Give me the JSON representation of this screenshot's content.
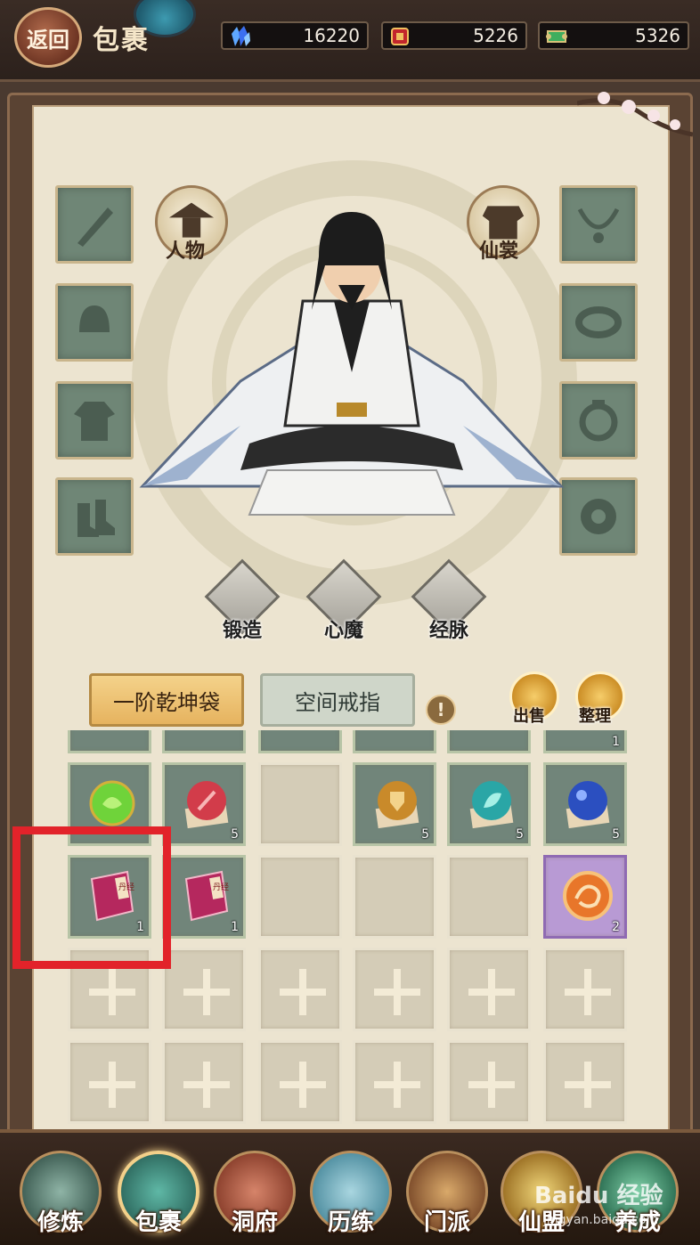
{
  "header": {
    "back_label": "返回",
    "title": "包裹"
  },
  "currencies": [
    {
      "icon": "crystal-icon",
      "value": "16220"
    },
    {
      "icon": "red-seal-icon",
      "value": "5226"
    },
    {
      "icon": "green-scroll-icon",
      "value": "5326"
    }
  ],
  "character_tabs": {
    "character_label": "人物",
    "outfit_label": "仙裳"
  },
  "equipment_slots_left": [
    "sword-icon",
    "helmet-icon",
    "robe-icon",
    "boots-icon"
  ],
  "equipment_slots_right": [
    "necklace-icon",
    "bracelet-icon",
    "ring-icon",
    "jade-icon"
  ],
  "actions": {
    "forge_label": "锻造",
    "heart_demon_label": "心魔",
    "meridian_label": "经脉"
  },
  "bag_tabs": {
    "bag_label": "一阶乾坤袋",
    "ring_label": "空间戒指"
  },
  "info_symbol": "!",
  "bag_actions": {
    "sell_label": "出售",
    "sort_label": "整理"
  },
  "inventory": {
    "partial_row": [
      {
        "filled": true,
        "count": ""
      },
      {
        "filled": true,
        "count": ""
      },
      {
        "filled": true,
        "count": ""
      },
      {
        "filled": true,
        "count": ""
      },
      {
        "filled": true,
        "count": ""
      },
      {
        "filled": true,
        "count": "1"
      }
    ],
    "row_orbs": [
      {
        "item": "green-spirit-orb",
        "color": "#6fd33a",
        "count": ""
      },
      {
        "item": "red-sword-orb",
        "color": "#d23c4a",
        "count": "5"
      },
      {
        "item": "empty",
        "color": "",
        "count": ""
      },
      {
        "item": "gold-shield-orb",
        "color": "#c98a2a",
        "count": "5"
      },
      {
        "item": "teal-leaf-orb",
        "color": "#2aa6a6",
        "count": "5"
      },
      {
        "item": "blue-dragon-orb",
        "color": "#2b4fc0",
        "count": "5"
      }
    ],
    "row_books": [
      {
        "item": "pill-scripture-book",
        "count": "1",
        "book_text": "丹经"
      },
      {
        "item": "pill-scripture-book",
        "count": "1",
        "book_text": "丹经"
      },
      {
        "item": "empty",
        "count": ""
      },
      {
        "item": "empty",
        "count": ""
      },
      {
        "item": "empty",
        "count": ""
      },
      {
        "item": "dragon-token",
        "count": "2"
      }
    ]
  },
  "bottom_nav": [
    {
      "label": "修炼",
      "icon": "cultivate-icon",
      "active": false
    },
    {
      "label": "包裹",
      "icon": "bag-icon",
      "active": true
    },
    {
      "label": "洞府",
      "icon": "cave-dwelling-icon",
      "active": false
    },
    {
      "label": "历练",
      "icon": "scroll-icon",
      "active": false
    },
    {
      "label": "门派",
      "icon": "sect-gate-icon",
      "active": false
    },
    {
      "label": "仙盟",
      "icon": "alliance-icon",
      "active": false
    },
    {
      "label": "养成",
      "icon": "growth-icon",
      "active": false
    }
  ],
  "watermark": {
    "text": "Baidu 经验",
    "url_text": "jingyan.baidu.com"
  }
}
